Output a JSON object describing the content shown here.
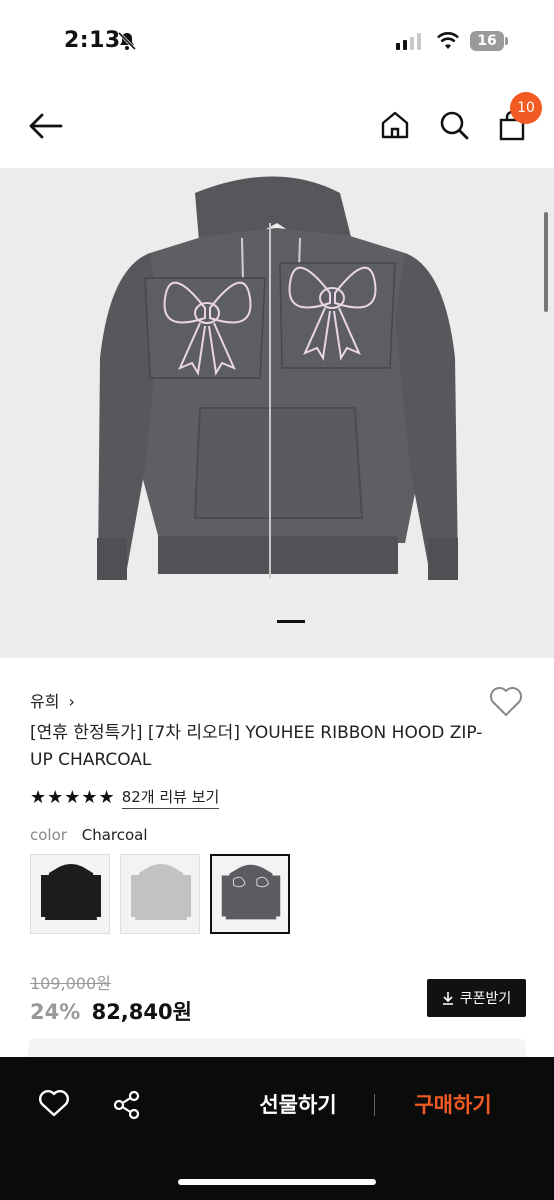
{
  "status_bar": {
    "time": "2:13",
    "battery": "16"
  },
  "nav": {
    "cart_count": "10",
    "back_icon": "arrow-left-icon",
    "home_icon": "home-icon",
    "search_icon": "search-icon",
    "cart_icon": "shopping-bag-icon"
  },
  "product": {
    "brand": "유희",
    "brand_chevron": "›",
    "title": "[연휴 한정특가] [7차 리오더] YOUHEE RIBBON HOOD ZIP-UP CHARCOAL",
    "rating_stars": "★★★★★",
    "review_link": "82개 리뷰 보기",
    "color_label": "color",
    "color_value": "Charcoal",
    "swatches": [
      "black",
      "light-gray",
      "charcoal"
    ],
    "original_price": "109,000원",
    "discount": "24%",
    "price": "82,840원",
    "coupon_label": "쿠폰받기"
  },
  "bottom_bar": {
    "gift_label": "선물하기",
    "buy_label": "구매하기"
  },
  "colors": {
    "accent": "#f15a22",
    "hoodie": "#5a5c60",
    "bar": "#0b0b0b"
  }
}
